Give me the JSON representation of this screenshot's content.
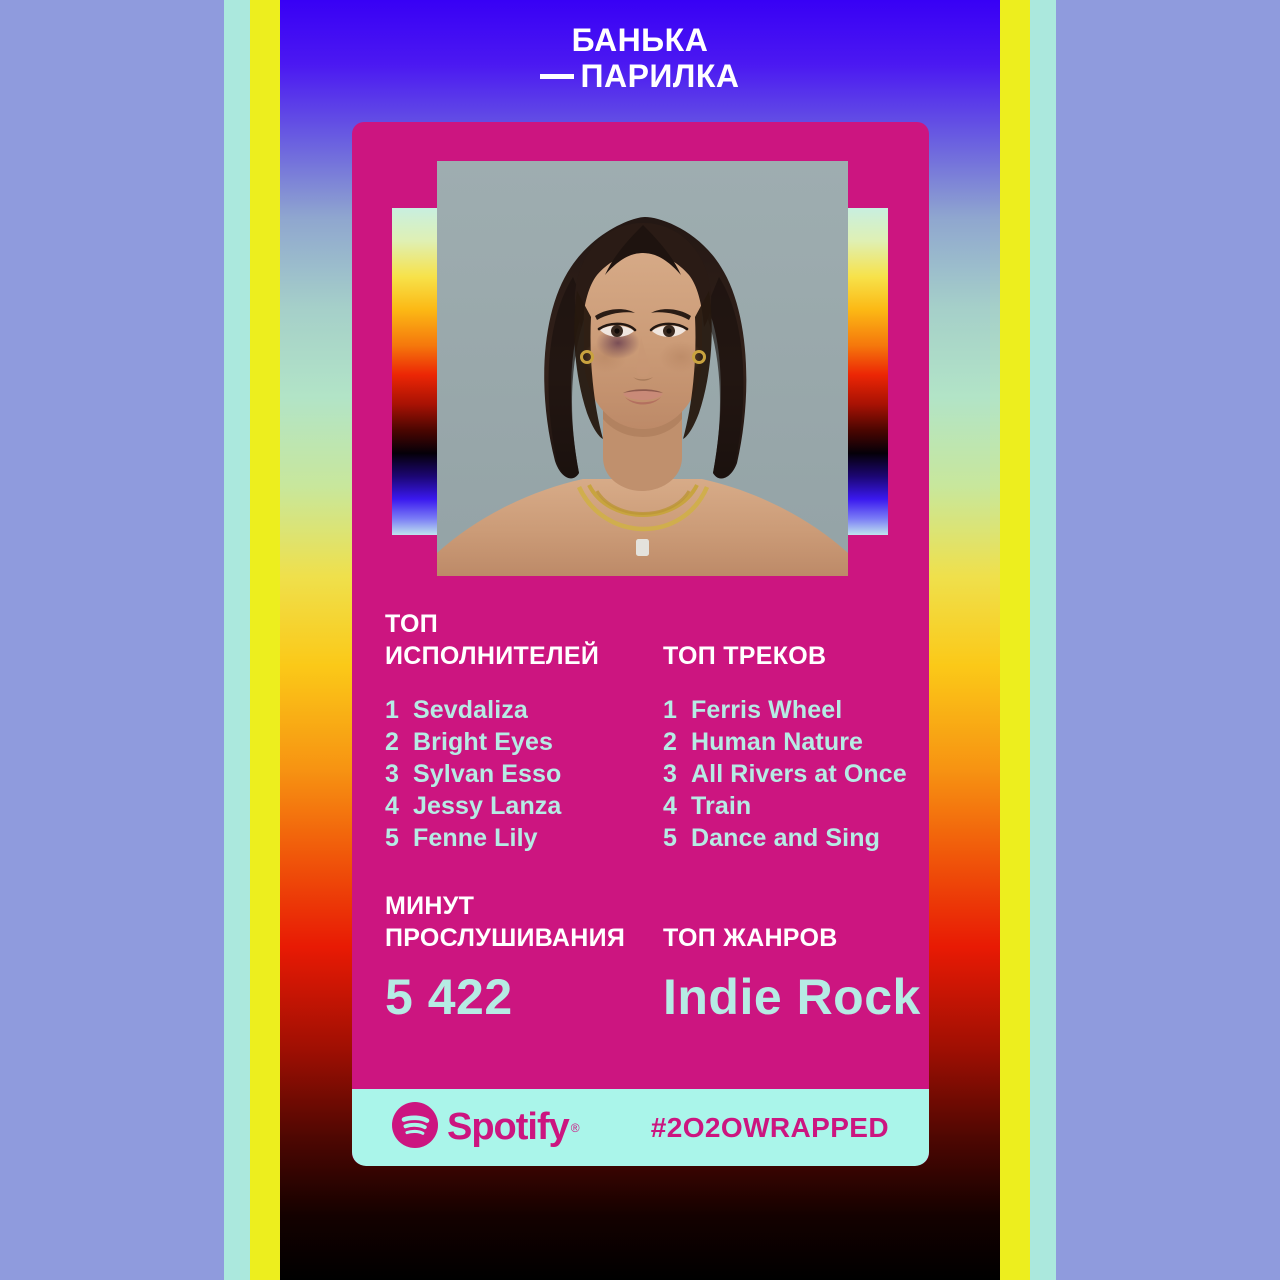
{
  "title": {
    "line1": "БАНЬКА",
    "line2": "ПАРИЛКА"
  },
  "card": {
    "artwork": {
      "alt": "portrait-photo-woman-dark-hair-gold-necklaces",
      "background_color": "#9aa8ab"
    },
    "top_artists": {
      "heading_line1": "ТОП",
      "heading_line2": "ИСПОЛНИТЕЛЕЙ",
      "items": [
        {
          "rank": "1",
          "name": "Sevdaliza"
        },
        {
          "rank": "2",
          "name": "Bright Eyes"
        },
        {
          "rank": "3",
          "name": "Sylvan Esso"
        },
        {
          "rank": "4",
          "name": "Jessy Lanza"
        },
        {
          "rank": "5",
          "name": "Fenne Lily"
        }
      ]
    },
    "top_tracks": {
      "heading_line1": "ТОП ТРЕКОВ",
      "heading_line2": "",
      "items": [
        {
          "rank": "1",
          "name": "Ferris Wheel"
        },
        {
          "rank": "2",
          "name": "Human Nature"
        },
        {
          "rank": "3",
          "name": "All Rivers at Once"
        },
        {
          "rank": "4",
          "name": "Train"
        },
        {
          "rank": "5",
          "name": "Dance and Sing"
        }
      ]
    },
    "minutes_listened": {
      "heading_line1": "МИНУТ",
      "heading_line2": "ПРОСЛУШИВАНИЯ",
      "value": "5 422"
    },
    "top_genre": {
      "heading_line1": "ТОП ЖАНРОВ",
      "value": "Indie Rock"
    }
  },
  "footer": {
    "brand": "Spotify",
    "trademark": "®",
    "hashtag": "#2O2OWRAPPED"
  },
  "colors": {
    "card_pink": "#cc1580",
    "mint_text": "#b6ebe4",
    "footer_mint": "#aaf5ea",
    "white": "#ffffff",
    "background_periwinkle": "#8f9bdd",
    "stripe_yellow": "#edee1e",
    "stripe_mint": "#abe8dd"
  }
}
